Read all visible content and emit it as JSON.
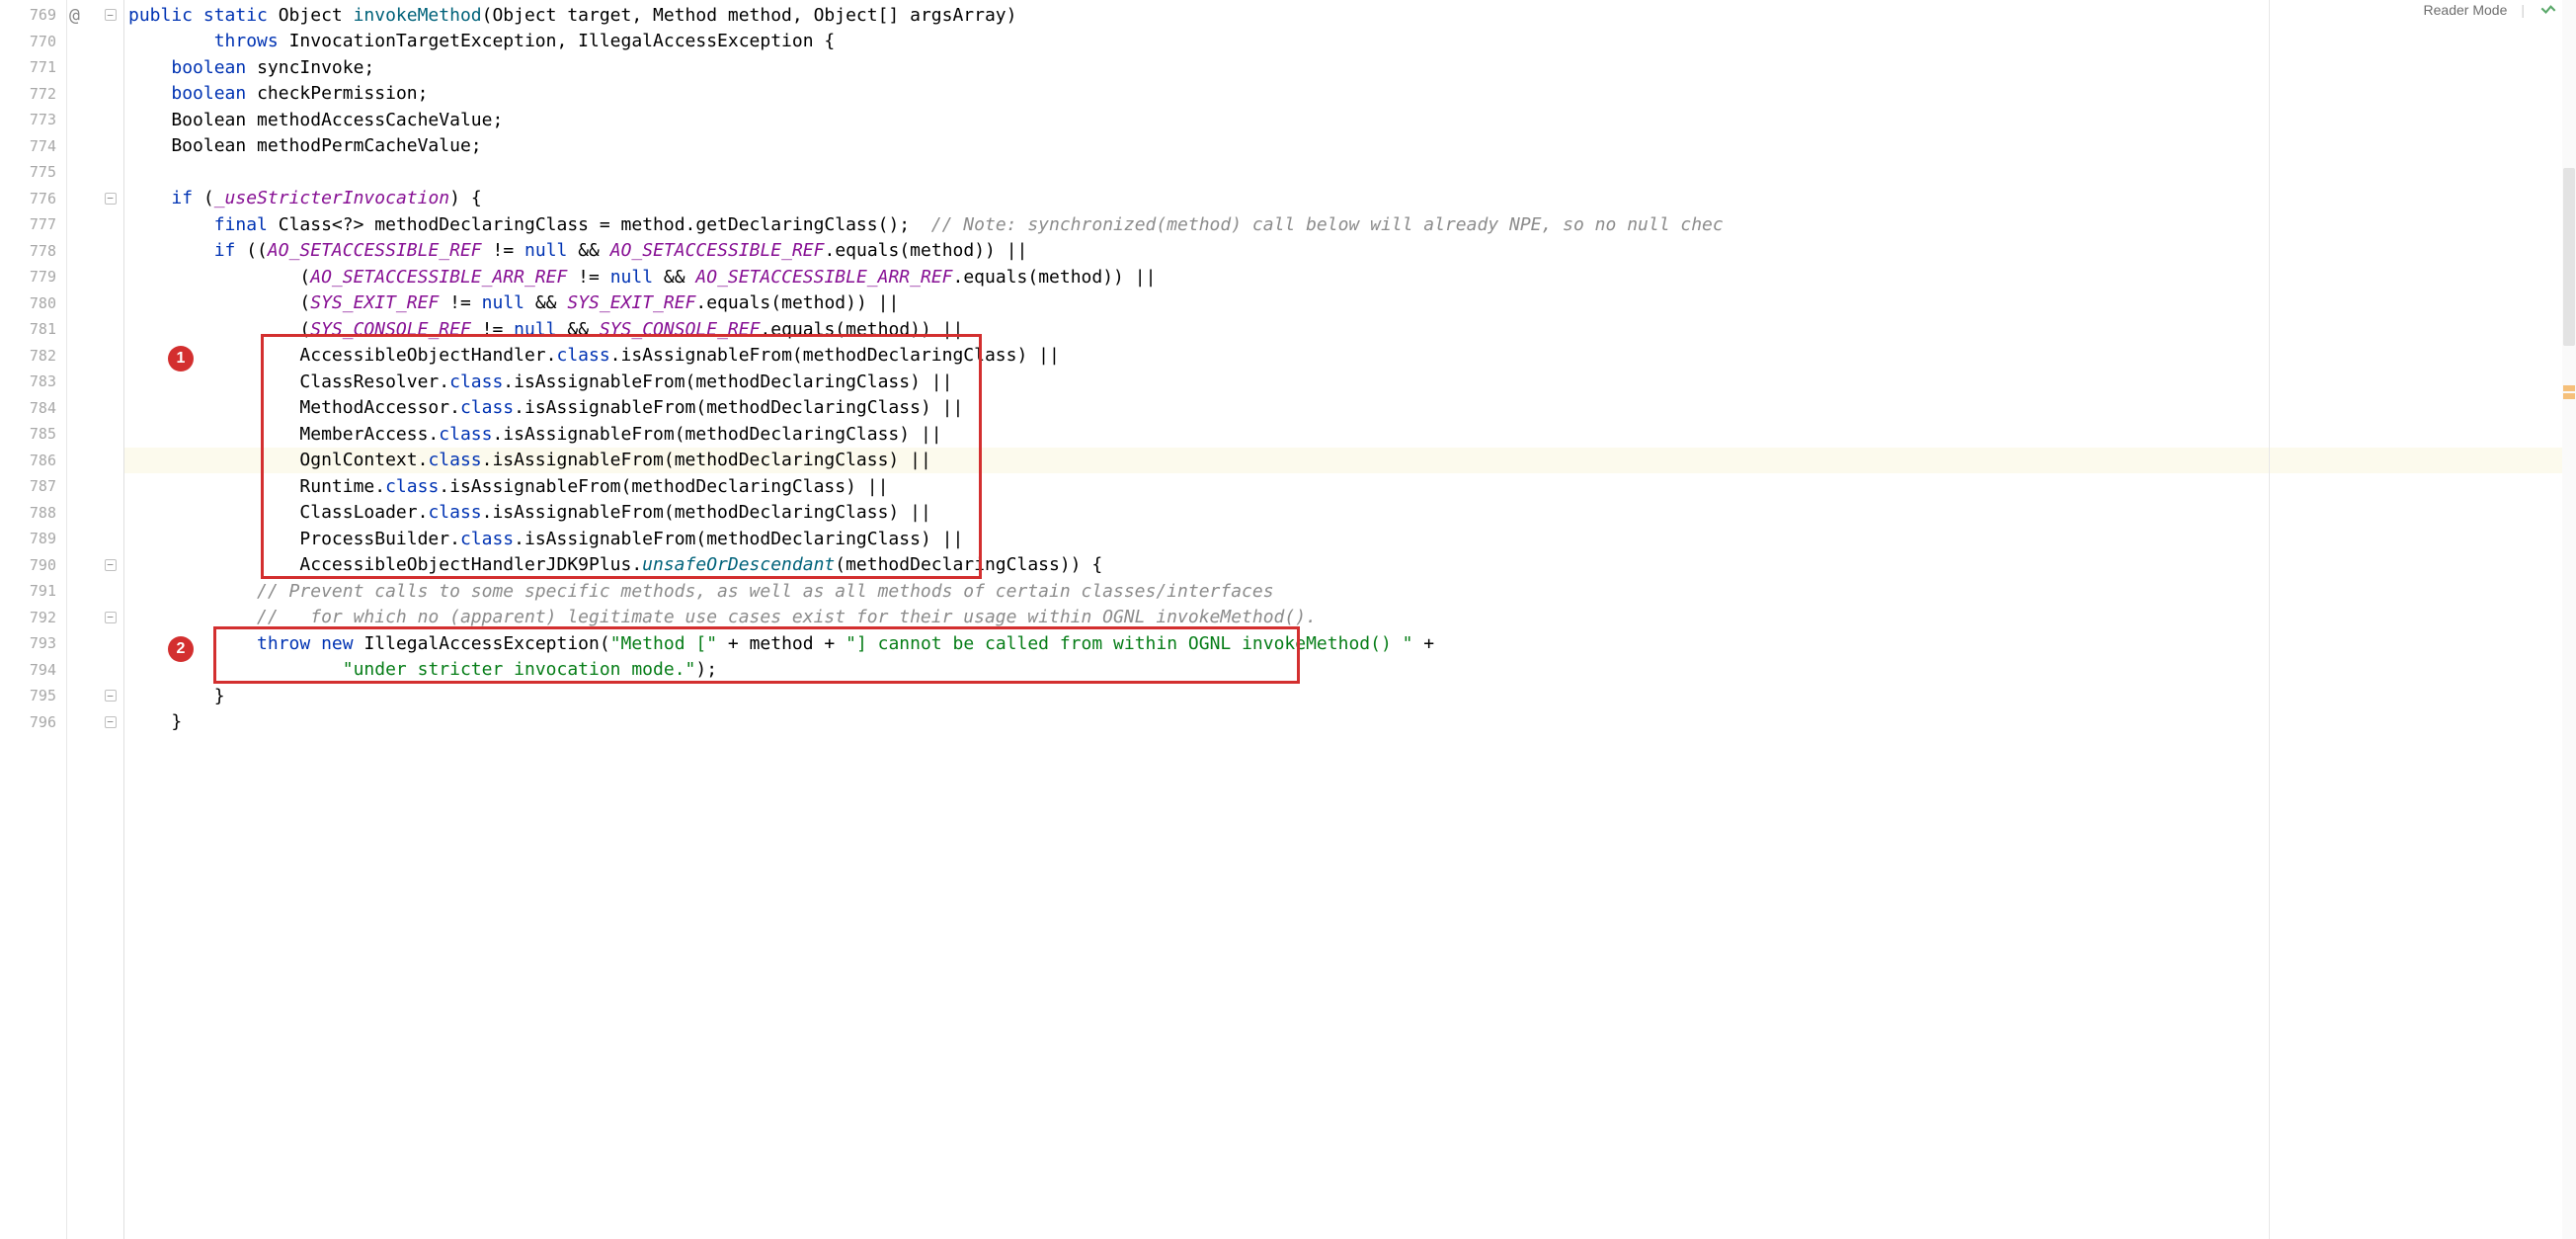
{
  "header": {
    "reader_mode": "Reader Mode"
  },
  "gutter": {
    "start": 769,
    "end": 796,
    "vcs_marker": "@",
    "fold_lines": [
      769,
      776,
      790,
      792,
      795,
      796
    ]
  },
  "annotations": {
    "badge1": "1",
    "badge2": "2"
  },
  "code": {
    "lines": [
      {
        "n": 769,
        "segments": [
          {
            "t": "public ",
            "c": "tok-kw"
          },
          {
            "t": "static ",
            "c": "tok-kw"
          },
          {
            "t": "Object ",
            "c": "tok-ident"
          },
          {
            "t": "invokeMethod",
            "c": "tok-method"
          },
          {
            "t": "(Object target, Method method, Object[] argsArray)",
            "c": "tok-ident"
          }
        ]
      },
      {
        "n": 770,
        "segments": [
          {
            "t": "        ",
            "c": ""
          },
          {
            "t": "throws ",
            "c": "tok-kw"
          },
          {
            "t": "InvocationTargetException, IllegalAccessException {",
            "c": "tok-ident"
          }
        ]
      },
      {
        "n": 771,
        "segments": [
          {
            "t": "    ",
            "c": ""
          },
          {
            "t": "boolean ",
            "c": "tok-kw"
          },
          {
            "t": "syncInvoke;",
            "c": "tok-ident"
          }
        ]
      },
      {
        "n": 772,
        "segments": [
          {
            "t": "    ",
            "c": ""
          },
          {
            "t": "boolean ",
            "c": "tok-kw"
          },
          {
            "t": "checkPermission;",
            "c": "tok-ident"
          }
        ]
      },
      {
        "n": 773,
        "segments": [
          {
            "t": "    Boolean methodAccessCacheValue;",
            "c": "tok-ident"
          }
        ]
      },
      {
        "n": 774,
        "segments": [
          {
            "t": "    Boolean methodPermCacheValue;",
            "c": "tok-ident"
          }
        ]
      },
      {
        "n": 775,
        "segments": [
          {
            "t": "",
            "c": ""
          }
        ]
      },
      {
        "n": 776,
        "segments": [
          {
            "t": "    ",
            "c": ""
          },
          {
            "t": "if ",
            "c": "tok-kw"
          },
          {
            "t": "(",
            "c": "tok-ident"
          },
          {
            "t": "_useStricterInvocation",
            "c": "tok-field"
          },
          {
            "t": ") {",
            "c": "tok-ident"
          }
        ]
      },
      {
        "n": 777,
        "segments": [
          {
            "t": "        ",
            "c": ""
          },
          {
            "t": "final ",
            "c": "tok-kw"
          },
          {
            "t": "Class<?> methodDeclaringClass = method.getDeclaringClass();  ",
            "c": "tok-ident"
          },
          {
            "t": "// Note: synchronized(method) call below will already NPE, so no null chec",
            "c": "tok-comment"
          }
        ]
      },
      {
        "n": 778,
        "segments": [
          {
            "t": "        ",
            "c": ""
          },
          {
            "t": "if ",
            "c": "tok-kw"
          },
          {
            "t": "((",
            "c": "tok-ident"
          },
          {
            "t": "AO_SETACCESSIBLE_REF",
            "c": "tok-field"
          },
          {
            "t": " != ",
            "c": "tok-ident"
          },
          {
            "t": "null",
            "c": "tok-kw"
          },
          {
            "t": " && ",
            "c": "tok-ident"
          },
          {
            "t": "AO_SETACCESSIBLE_REF",
            "c": "tok-field"
          },
          {
            "t": ".equals(method)) ||",
            "c": "tok-ident"
          }
        ]
      },
      {
        "n": 779,
        "segments": [
          {
            "t": "                (",
            "c": "tok-ident"
          },
          {
            "t": "AO_SETACCESSIBLE_ARR_REF",
            "c": "tok-field"
          },
          {
            "t": " != ",
            "c": "tok-ident"
          },
          {
            "t": "null",
            "c": "tok-kw"
          },
          {
            "t": " && ",
            "c": "tok-ident"
          },
          {
            "t": "AO_SETACCESSIBLE_ARR_REF",
            "c": "tok-field"
          },
          {
            "t": ".equals(method)) ||",
            "c": "tok-ident"
          }
        ]
      },
      {
        "n": 780,
        "segments": [
          {
            "t": "                (",
            "c": "tok-ident"
          },
          {
            "t": "SYS_EXIT_REF",
            "c": "tok-field"
          },
          {
            "t": " != ",
            "c": "tok-ident"
          },
          {
            "t": "null",
            "c": "tok-kw"
          },
          {
            "t": " && ",
            "c": "tok-ident"
          },
          {
            "t": "SYS_EXIT_REF",
            "c": "tok-field"
          },
          {
            "t": ".equals(method)) ||",
            "c": "tok-ident"
          }
        ]
      },
      {
        "n": 781,
        "segments": [
          {
            "t": "                (",
            "c": "tok-ident"
          },
          {
            "t": "SYS_CONSOLE_REF",
            "c": "tok-field"
          },
          {
            "t": " != ",
            "c": "tok-ident"
          },
          {
            "t": "null",
            "c": "tok-kw"
          },
          {
            "t": " && ",
            "c": "tok-ident"
          },
          {
            "t": "SYS_CONSOLE_REF",
            "c": "tok-field"
          },
          {
            "t": ".equals(method)) ||",
            "c": "tok-ident"
          }
        ]
      },
      {
        "n": 782,
        "segments": [
          {
            "t": "                AccessibleObjectHandler.",
            "c": "tok-ident"
          },
          {
            "t": "class",
            "c": "tok-class-kw"
          },
          {
            "t": ".isAssignableFrom(methodDeclaringClass) ||",
            "c": "tok-ident"
          }
        ]
      },
      {
        "n": 783,
        "segments": [
          {
            "t": "                ClassResolver.",
            "c": "tok-ident"
          },
          {
            "t": "class",
            "c": "tok-class-kw"
          },
          {
            "t": ".isAssignableFrom(methodDeclaringClass) ||",
            "c": "tok-ident"
          }
        ]
      },
      {
        "n": 784,
        "segments": [
          {
            "t": "                MethodAccessor.",
            "c": "tok-ident"
          },
          {
            "t": "class",
            "c": "tok-class-kw"
          },
          {
            "t": ".isAssignableFrom(methodDeclaringClass) ||",
            "c": "tok-ident"
          }
        ]
      },
      {
        "n": 785,
        "segments": [
          {
            "t": "                MemberAccess.",
            "c": "tok-ident"
          },
          {
            "t": "class",
            "c": "tok-class-kw"
          },
          {
            "t": ".isAssignableFrom(methodDeclaringClass) ||",
            "c": "tok-ident"
          }
        ]
      },
      {
        "n": 786,
        "hl": true,
        "segments": [
          {
            "t": "                OgnlContext.",
            "c": "tok-ident"
          },
          {
            "t": "class",
            "c": "tok-class-kw"
          },
          {
            "t": ".isAssignableFrom(methodDeclaringClass) ||",
            "c": "tok-ident"
          }
        ]
      },
      {
        "n": 787,
        "segments": [
          {
            "t": "                Runtime.",
            "c": "tok-ident"
          },
          {
            "t": "class",
            "c": "tok-class-kw"
          },
          {
            "t": ".isAssignableFrom(methodDeclaringClass) ||",
            "c": "tok-ident"
          }
        ]
      },
      {
        "n": 788,
        "segments": [
          {
            "t": "                ClassLoader.",
            "c": "tok-ident"
          },
          {
            "t": "class",
            "c": "tok-class-kw"
          },
          {
            "t": ".isAssignableFrom(methodDeclaringClass) ||",
            "c": "tok-ident"
          }
        ]
      },
      {
        "n": 789,
        "segments": [
          {
            "t": "                ProcessBuilder.",
            "c": "tok-ident"
          },
          {
            "t": "class",
            "c": "tok-class-kw"
          },
          {
            "t": ".isAssignableFrom(methodDeclaringClass) ||",
            "c": "tok-ident"
          }
        ]
      },
      {
        "n": 790,
        "segments": [
          {
            "t": "                AccessibleObjectHandlerJDK9Plus.",
            "c": "tok-ident"
          },
          {
            "t": "unsafeOrDescendant",
            "c": "tok-italic-method"
          },
          {
            "t": "(methodDeclaringClass)) {",
            "c": "tok-ident"
          }
        ]
      },
      {
        "n": 791,
        "segments": [
          {
            "t": "            ",
            "c": ""
          },
          {
            "t": "// Prevent calls to some specific methods, as well as all methods of certain classes/interfaces",
            "c": "tok-comment"
          }
        ]
      },
      {
        "n": 792,
        "segments": [
          {
            "t": "            ",
            "c": ""
          },
          {
            "t": "//   for which no (apparent) legitimate use cases exist for their usage within OGNL invokeMethod().",
            "c": "tok-comment"
          }
        ]
      },
      {
        "n": 793,
        "segments": [
          {
            "t": "            ",
            "c": ""
          },
          {
            "t": "throw ",
            "c": "tok-kw"
          },
          {
            "t": "new ",
            "c": "tok-kw"
          },
          {
            "t": "IllegalAccessException(",
            "c": "tok-ident"
          },
          {
            "t": "\"Method [\"",
            "c": "tok-string"
          },
          {
            "t": " + method + ",
            "c": "tok-ident"
          },
          {
            "t": "\"] cannot be called from within OGNL invokeMethod() \"",
            "c": "tok-string"
          },
          {
            "t": " +",
            "c": "tok-ident"
          }
        ]
      },
      {
        "n": 794,
        "segments": [
          {
            "t": "                    ",
            "c": ""
          },
          {
            "t": "\"under stricter invocation mode.\"",
            "c": "tok-string"
          },
          {
            "t": ");",
            "c": "tok-ident"
          }
        ]
      },
      {
        "n": 795,
        "segments": [
          {
            "t": "        }",
            "c": "tok-ident"
          }
        ]
      },
      {
        "n": 796,
        "segments": [
          {
            "t": "    }",
            "c": "tok-ident"
          }
        ]
      }
    ]
  }
}
